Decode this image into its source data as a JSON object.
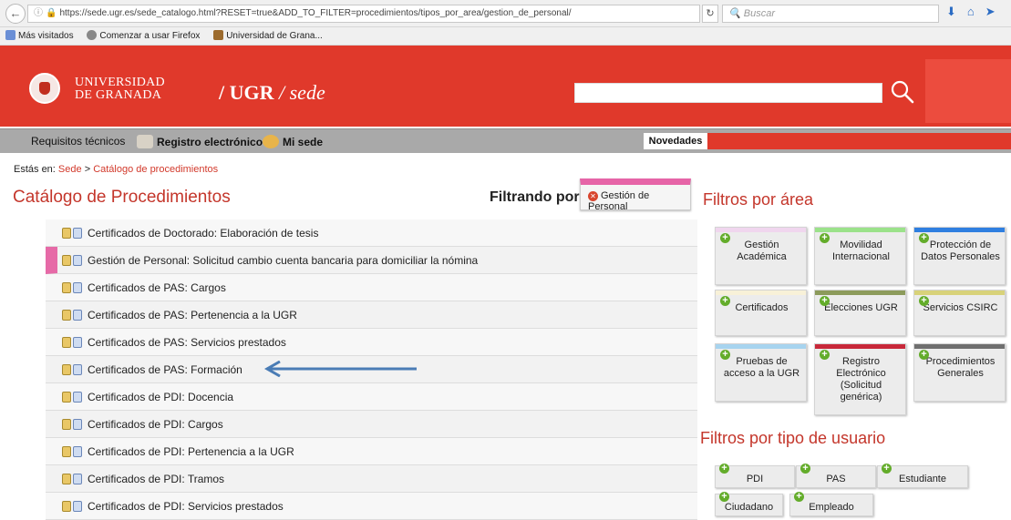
{
  "browser": {
    "url": "https://sede.ugr.es/sede_catalogo.html?RESET=true&ADD_TO_FILTER=procedimientos/tipos_por_area/gestion_de_personal/",
    "search_placeholder": "Buscar",
    "bookmarks": [
      "Más visitados",
      "Comenzar a usar Firefox",
      "Universidad de Grana..."
    ]
  },
  "header": {
    "uni_line1": "UNIVERSIDAD",
    "uni_line2": "DE GRANADA",
    "brand_ugr": "/ UGR",
    "brand_sede": "/ sede"
  },
  "nav": {
    "req": "Requisitos técnicos",
    "registro": "Registro electrónico",
    "misede": "Mi sede",
    "novedades": "Novedades"
  },
  "breadcrumb": {
    "prefix": "Estás en:",
    "sede": "Sede",
    "sep": ">",
    "catalogo": "Catálogo de procedimientos"
  },
  "catalog": {
    "title": "Catálogo de Procedimientos",
    "filter_label": "Filtrando por:",
    "filter_chip": "Gestión de Personal",
    "filter_color": "#e664a7",
    "items": [
      "Certificados de Doctorado: Elaboración de tesis",
      "Gestión de Personal: Solicitud cambio cuenta bancaria para domiciliar la nómina",
      "Certificados de PAS: Cargos",
      "Certificados de PAS: Pertenencia a la UGR",
      "Certificados de PAS: Servicios prestados",
      "Certificados de PAS: Formación",
      "Certificados de PDI: Docencia",
      "Certificados de PDI: Cargos",
      "Certificados de PDI: Pertenencia a la UGR",
      "Certificados de PDI: Tramos",
      "Certificados de PDI: Servicios prestados"
    ]
  },
  "areas": {
    "title": "Filtros por área",
    "tiles": [
      {
        "label": "Gestión Académica",
        "color": "#f0d6ee"
      },
      {
        "label": "Movilidad Internacional",
        "color": "#9be28a"
      },
      {
        "label": "Protección de Datos Personales",
        "color": "#2f7fe0"
      },
      {
        "label": "Certificados",
        "color": "#f8f1d8"
      },
      {
        "label": "Elecciones UGR",
        "color": "#8c9b5b"
      },
      {
        "label": "Servicios CSIRC",
        "color": "#d8d27a"
      },
      {
        "label": "Pruebas de acceso a la UGR",
        "color": "#a7d4ef"
      },
      {
        "label": "Registro Electrónico (Solicitud genérica)",
        "color": "#c8283a"
      },
      {
        "label": "Procedimientos Generales",
        "color": "#6f6f6f"
      }
    ]
  },
  "users": {
    "title": "Filtros por tipo de usuario",
    "tiles": [
      "PDI",
      "PAS",
      "Estudiante",
      "Ciudadano",
      "Empleado"
    ]
  }
}
